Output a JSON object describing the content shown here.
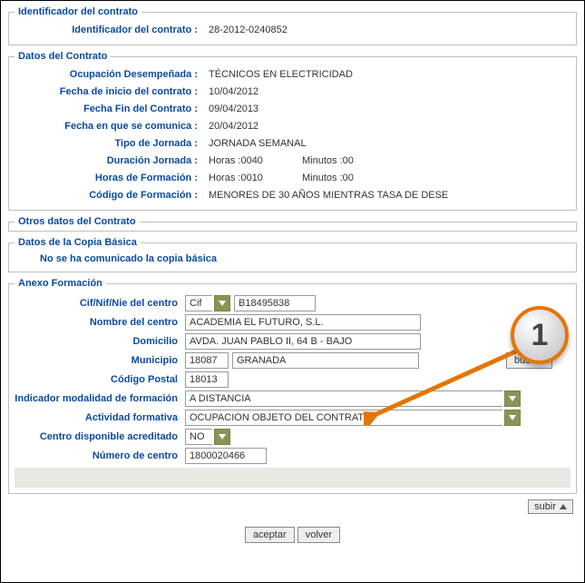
{
  "ident": {
    "legend": "Identificador del contrato",
    "label": "Identificador del contrato",
    "value": "28-2012-0240852"
  },
  "datos": {
    "legend": "Datos del Contrato",
    "ocupacion_label": "Ocupación Desempeñada",
    "ocupacion_value": "TÉCNICOS EN ELECTRICIDAD",
    "inicio_label": "Fecha de inicio del contrato",
    "inicio_value": "10/04/2012",
    "fin_label": "Fecha Fin del Contrato",
    "fin_value": "09/04/2013",
    "comunica_label": "Fecha en que se comunica",
    "comunica_value": "20/04/2012",
    "tipo_label": "Tipo de Jornada",
    "tipo_value": "JORNADA SEMANAL",
    "duracion_label": "Duración Jornada",
    "duracion_horas": "Horas :0040",
    "duracion_minutos": "Minutos :00",
    "formacion_label": "Horas de Formación",
    "formacion_horas": "Horas :0010",
    "formacion_minutos": "Minutos :00",
    "codigo_label": "Código de Formación",
    "codigo_value": "MENORES DE 30 AÑOS MIENTRAS TASA DE DESE"
  },
  "otros": {
    "legend": "Otros datos del Contrato"
  },
  "copia": {
    "legend": "Datos de la Copia Básica",
    "note": "No se ha comunicado la copia básica"
  },
  "anexo": {
    "legend": "Anexo Formación",
    "cif_label": "Cif/Nif/Nie del centro",
    "cif_type": "Cif",
    "cif_value": "B18495838",
    "nombre_label": "Nombre del centro",
    "nombre_value": "ACADEMIA EL FUTURO, S.L.",
    "domicilio_label": "Domicilio",
    "domicilio_value": "AVDA. JUAN PABLO II, 64 B - BAJO",
    "municipio_label": "Municipio",
    "municipio_code": "18087",
    "municipio_name": "GRANADA",
    "buscar_label": "buscar",
    "cp_label": "Código Postal",
    "cp_value": "18013",
    "indicador_label": "Indicador modalidad de formación",
    "indicador_value": "A DISTANCIA",
    "actividad_label": "Actividad formativa",
    "actividad_value": "OCUPACIÓN OBJETO DEL CONTRATO",
    "acreditado_label": "Centro disponible acreditado",
    "acreditado_value": "NO",
    "numero_label": "Número de centro",
    "numero_value": "1800020466"
  },
  "footer": {
    "subir": "subir",
    "aceptar": "aceptar",
    "volver": "volver"
  },
  "callout": {
    "num": "1"
  }
}
